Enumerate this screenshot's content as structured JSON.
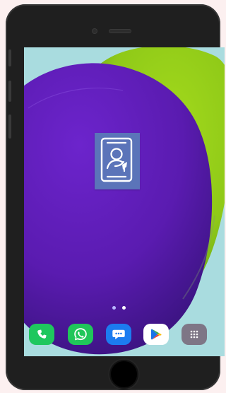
{
  "device": {
    "frame_color": "#1f1f1f",
    "background_color": "#fcf0f0"
  },
  "wallpaper": {
    "colors": {
      "background": "#a9dcdf",
      "purple": "#5a1bb0",
      "green": "#8fc918"
    }
  },
  "home_screen": {
    "app_icon": {
      "icon": "contact-profile-icon",
      "background_color": "#5b74b9"
    },
    "page_indicators": [
      {
        "state": "inactive",
        "color": "#b9b7ff"
      },
      {
        "state": "active",
        "color": "#ffffff"
      }
    ],
    "dock": [
      {
        "app": "phone",
        "icon": "phone-icon",
        "color": "#1fc75e"
      },
      {
        "app": "whatsapp",
        "icon": "whatsapp-icon",
        "color": "#20c65a"
      },
      {
        "app": "messages",
        "icon": "message-icon",
        "color": "#1c7cf0"
      },
      {
        "app": "play-store",
        "icon": "play-store-icon",
        "color": "#ffffff"
      },
      {
        "app": "app-drawer",
        "icon": "grid-icon",
        "color": "#7e7686"
      }
    ]
  }
}
